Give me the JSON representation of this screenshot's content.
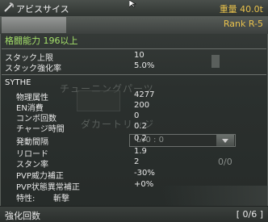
{
  "header": {
    "name": "アビスサイス",
    "weight": "重量 40.0t",
    "weapon_icon": "scythe-icon"
  },
  "item": {
    "rank": "Rank R-5",
    "requirement": "格闘能力 196以上"
  },
  "base": [
    {
      "label": "スタック上限",
      "value": "10"
    },
    {
      "label": "スタック強化率",
      "value": "5.0%"
    }
  ],
  "section_title": "SYTHE",
  "ghost_text": {
    "tuning": "チューニングパーツ",
    "cartridge": "ダカートリッジ"
  },
  "stats": [
    {
      "label": "物理属性",
      "value": "4277"
    },
    {
      "label": "EN消費",
      "value": "200"
    },
    {
      "label": "コンボ回数",
      "value": "0"
    },
    {
      "label": "チャージ時間",
      "value": "0.2"
    },
    {
      "label": "発動間隔",
      "value": "0.2"
    },
    {
      "label": "リロード",
      "value": "1.9"
    },
    {
      "label": "スタン率",
      "value": "2"
    },
    {
      "label": "PVP威力補正",
      "value": "-30%"
    },
    {
      "label": "PVP状態異常補正",
      "value": "+0%"
    },
    {
      "label": "特性:",
      "value": ""
    }
  ],
  "trait_value": "斬撃",
  "level_select": "Lv0 : 0",
  "slot_count": "0/0",
  "footer": {
    "label": "強化回数",
    "value": "[ 0/6 ]"
  },
  "colors": {
    "accent": "#e9c24c",
    "requirement": "#a4e06a"
  }
}
